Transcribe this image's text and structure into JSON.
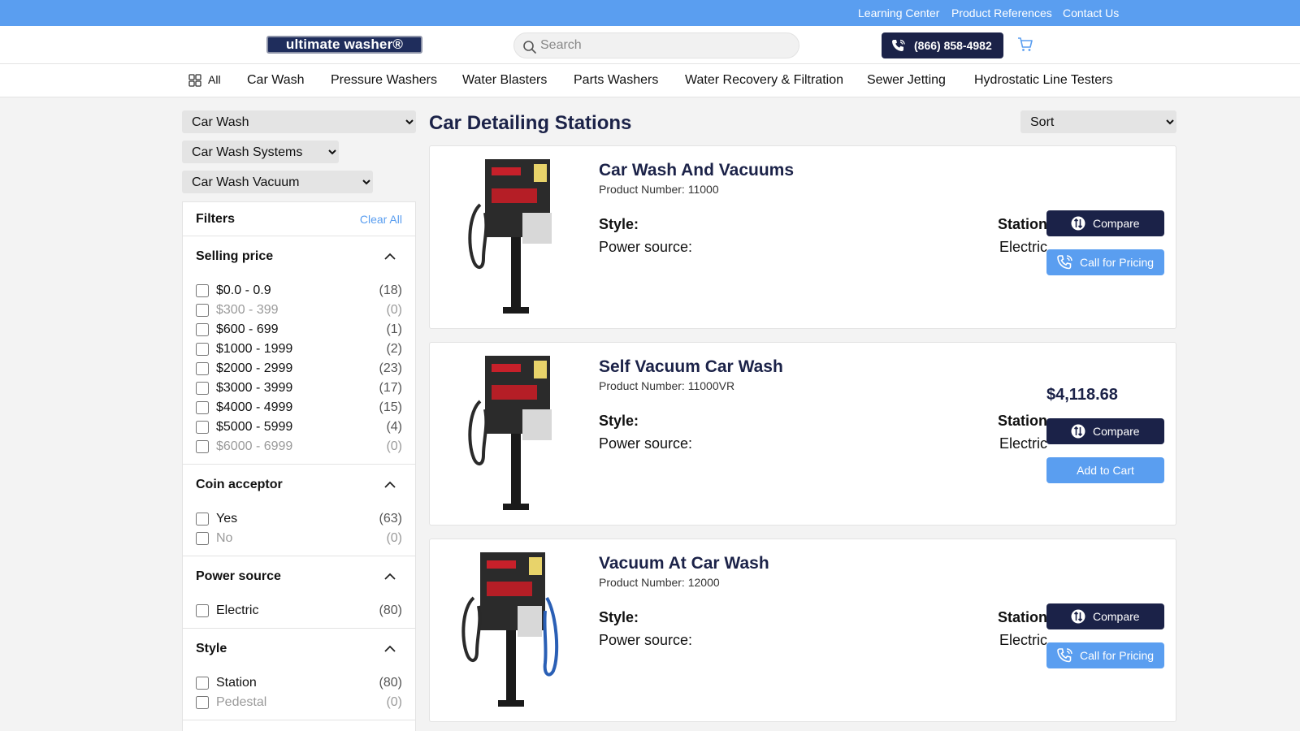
{
  "topbar": {
    "links": [
      "Learning Center",
      "Product References",
      "Contact Us"
    ]
  },
  "header": {
    "logo_text": "ultimate washer®",
    "search_placeholder": "Search",
    "phone": "(866) 858-4982"
  },
  "nav": {
    "all_label": "All",
    "items": [
      "Car Wash",
      "Pressure Washers",
      "Water Blasters",
      "Parts Washers",
      "Water Recovery & Filtration",
      "Sewer Jetting",
      "Hydrostatic Line Testers"
    ]
  },
  "category_selects": [
    "Car Wash",
    "Car Wash Systems",
    "Car Wash Vacuum"
  ],
  "filters": {
    "title": "Filters",
    "clear_label": "Clear All",
    "sections": [
      {
        "title": "Selling price",
        "options": [
          {
            "label": "$0.0 - 0.9",
            "count": "(18)"
          },
          {
            "label": "$300 - 399",
            "count": "(0)"
          },
          {
            "label": "$600 - 699",
            "count": "(1)"
          },
          {
            "label": "$1000 - 1999",
            "count": "(2)"
          },
          {
            "label": "$2000 - 2999",
            "count": "(23)"
          },
          {
            "label": "$3000 - 3999",
            "count": "(17)"
          },
          {
            "label": "$4000 - 4999",
            "count": "(15)"
          },
          {
            "label": "$5000 - 5999",
            "count": "(4)"
          },
          {
            "label": "$6000 - 6999",
            "count": "(0)"
          }
        ]
      },
      {
        "title": "Coin acceptor",
        "options": [
          {
            "label": "Yes",
            "count": "(63)"
          },
          {
            "label": "No",
            "count": "(0)"
          }
        ]
      },
      {
        "title": "Power source",
        "options": [
          {
            "label": "Electric",
            "count": "(80)"
          }
        ]
      },
      {
        "title": "Style",
        "options": [
          {
            "label": "Station",
            "count": "(80)"
          },
          {
            "label": "Pedestal",
            "count": "(0)"
          }
        ]
      }
    ]
  },
  "main": {
    "title": "Car Detailing Stations",
    "sort_label": "Sort",
    "style_label": "Style:",
    "power_label": "Power source:",
    "compare_label": "Compare",
    "products": [
      {
        "name": "Car Wash And Vacuums",
        "number": "Product Number: 11000",
        "style": "Station",
        "power": "Electric",
        "price": "",
        "action": "Call for Pricing"
      },
      {
        "name": "Self Vacuum Car Wash",
        "number": "Product Number: 11000VR",
        "style": "Station",
        "power": "Electric",
        "price": "$4,118.68",
        "action": "Add to Cart"
      },
      {
        "name": "Vacuum At Car Wash",
        "number": "Product Number: 12000",
        "style": "Station",
        "power": "Electric",
        "price": "",
        "action": "Call for Pricing"
      }
    ]
  }
}
